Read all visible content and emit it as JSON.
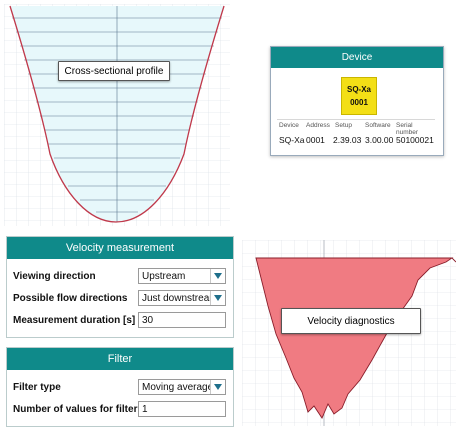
{
  "cross_section": {
    "label": "Cross-sectional profile"
  },
  "device": {
    "title": "Device",
    "name": "SQ-Xa",
    "address": "0001",
    "columns": [
      "Device",
      "Address",
      "Setup",
      "Software",
      "Serial number"
    ],
    "values": [
      "SQ-Xa",
      "0001",
      "2.39.03",
      "3.00.00",
      "50100021"
    ]
  },
  "velocity_measurement": {
    "title": "Velocity measurement",
    "viewing_direction": {
      "label": "Viewing direction",
      "value": "Upstream"
    },
    "flow_directions": {
      "label": "Possible flow directions",
      "value": "Just downstream"
    },
    "duration": {
      "label": "Measurement duration [s]",
      "value": "30"
    }
  },
  "filter": {
    "title": "Filter",
    "filter_type": {
      "label": "Filter type",
      "value": "Moving average"
    },
    "num_values": {
      "label": "Number of values for filter",
      "value": "1"
    }
  },
  "velocity_diagnostics": {
    "label": "Velocity diagnostics"
  },
  "colors": {
    "accent": "#0f8a8a",
    "profile_line": "#c0394b",
    "chip": "#f3df16",
    "diag_fill": "#f07b82"
  },
  "icons": {
    "dropdown": "triangle-down-icon"
  }
}
